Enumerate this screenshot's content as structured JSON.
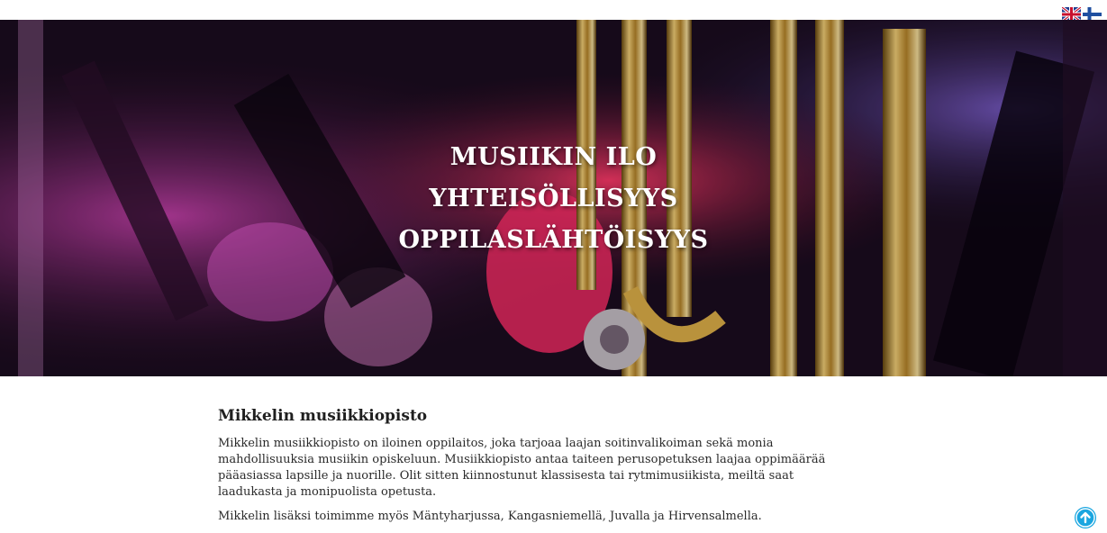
{
  "header": {
    "languages": [
      {
        "code": "en",
        "icon": "uk-flag-icon"
      },
      {
        "code": "fi",
        "icon": "finland-flag-icon"
      }
    ]
  },
  "hero": {
    "lines": [
      "MUSIIKIN ILO",
      "YHTEISÖLLISYYS",
      "OPPILASLÄHTÖISYYS"
    ],
    "image": "brass-instrument-photo"
  },
  "main": {
    "title": "Mikkelin musiikkiopisto",
    "paragraphs": [
      "Mikkelin musiikkiopisto on iloinen oppilaitos, joka tarjoaa laajan soitinvalikoiman sekä monia mahdollisuuksia musiikin opiskeluun. Musiikkiopisto antaa taiteen perusopetuksen laajaa oppimäärää pääasiassa lapsille ja nuorille. Olit sitten kiinnostunut klassisesta tai rytmimusiikista, meiltä saat laadukasta ja monipuolista opetusta.",
      "Mikkelin lisäksi toimimme myös Mäntyharjussa, Kangasniemellä, Juvalla ja Hirvensalmella."
    ]
  },
  "scroll_top": {
    "icon": "arrow-up-icon",
    "color": "#1aa6e0"
  },
  "colors": {
    "accent": "#1aa6e0",
    "hero_text": "#ffffff"
  }
}
